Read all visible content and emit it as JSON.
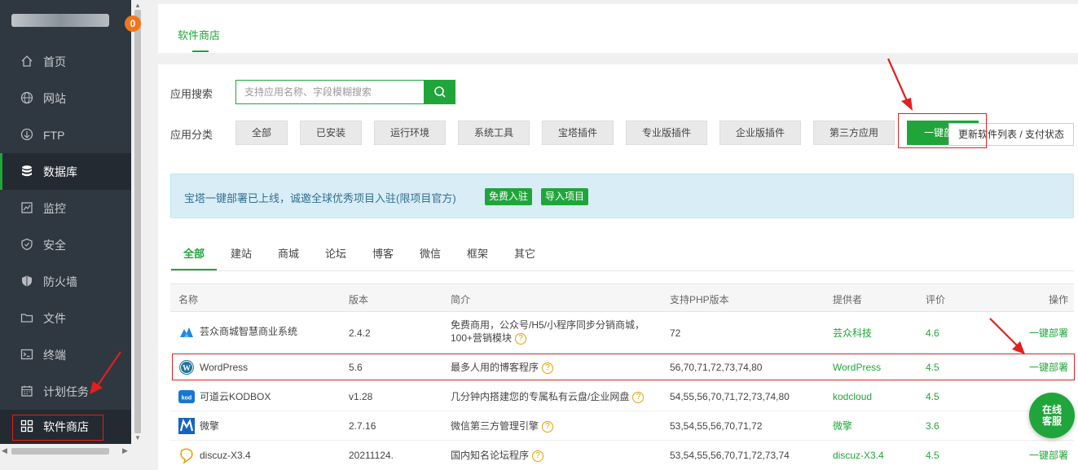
{
  "sidebar": {
    "badge": "0",
    "items": [
      {
        "label": "首页",
        "icon": "home-icon"
      },
      {
        "label": "网站",
        "icon": "globe-icon"
      },
      {
        "label": "FTP",
        "icon": "ftp-icon"
      },
      {
        "label": "数据库",
        "icon": "database-icon"
      },
      {
        "label": "监控",
        "icon": "monitor-icon"
      },
      {
        "label": "安全",
        "icon": "shield-icon"
      },
      {
        "label": "防火墙",
        "icon": "firewall-icon"
      },
      {
        "label": "文件",
        "icon": "folder-icon"
      },
      {
        "label": "终端",
        "icon": "terminal-icon"
      },
      {
        "label": "计划任务",
        "icon": "calendar-icon"
      },
      {
        "label": "软件商店",
        "icon": "grid-icon"
      }
    ]
  },
  "top_tab": "软件商店",
  "search": {
    "label": "应用搜索",
    "placeholder": "支持应用名称、字段模糊搜索"
  },
  "category": {
    "label": "应用分类",
    "buttons": [
      "全部",
      "已安装",
      "运行环境",
      "系统工具",
      "宝塔插件",
      "专业版插件",
      "企业版插件",
      "第三方应用",
      "一键部"
    ],
    "tooltip": "更新软件列表 / 支付状态"
  },
  "notice": {
    "text": "宝塔一键部署已上线，诚邀全球优秀项目入驻(限项目官方)",
    "btn1": "免费入驻",
    "btn2": "导入项目"
  },
  "subtabs": [
    "全部",
    "建站",
    "商城",
    "论坛",
    "博客",
    "微信",
    "框架",
    "其它"
  ],
  "table": {
    "headers": [
      "名称",
      "版本",
      "简介",
      "支持PHP版本",
      "提供者",
      "评价",
      "操作"
    ],
    "rows": [
      {
        "name": "芸众商城智慧商业系统",
        "version": "2.4.2",
        "desc1": "免费商用，公众号/H5/小程序同步分销商城，",
        "desc2": "100+营销模块",
        "php": "72",
        "provider": "芸众科技",
        "rating": "4.6",
        "action": "一键部署",
        "icon": "yunzhong-icon"
      },
      {
        "name": "WordPress",
        "version": "5.6",
        "desc1": "最多人用的博客程序",
        "desc2": "",
        "php": "56,70,71,72,73,74,80",
        "provider": "WordPress",
        "rating": "4.5",
        "action": "一键部署",
        "icon": "wordpress-icon"
      },
      {
        "name": "可道云KODBOX",
        "version": "v1.28",
        "desc1": "几分钟内搭建您的专属私有云盘/企业网盘",
        "desc2": "",
        "php": "54,55,56,70,71,72,73,74,80",
        "provider": "kodcloud",
        "rating": "4.5",
        "action": "",
        "icon": "kod-icon"
      },
      {
        "name": "微擎",
        "version": "2.7.16",
        "desc1": "微信第三方管理引擎",
        "desc2": "",
        "php": "53,54,55,56,70,71,72",
        "provider": "微擎",
        "rating": "3.6",
        "action": "",
        "icon": "weiqing-icon"
      },
      {
        "name": "discuz-X3.4",
        "version": "20211124.",
        "desc1": "国内知名论坛程序",
        "desc2": "",
        "php": "53,54,55,56,70,71,72,73,74",
        "provider": "discuz-X3.4",
        "rating": "4.5",
        "action": "一键部署",
        "icon": "discuz-icon"
      }
    ]
  },
  "chat": {
    "line1": "在线",
    "line2": "客服"
  }
}
